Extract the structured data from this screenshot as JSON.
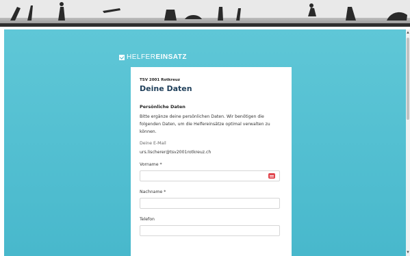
{
  "brand": {
    "light": "HELFER",
    "bold": "EINSATZ"
  },
  "club": "TSV 2001 Rotkreuz",
  "page_title": "Deine Daten",
  "section_title": "Persönliche Daten",
  "intro": "Bitte ergänze deine persönlichen Daten. Wir benötigen die folgenden Daten, um die Helfereinsätze optimal verwalten zu können.",
  "email": {
    "label": "Deine E-Mail",
    "value": "urs.lischerer@tsv2001rotkreuz.ch"
  },
  "fields": [
    {
      "label": "Vorname",
      "required": "*",
      "value": "",
      "error_icon": "password-manager-icon"
    },
    {
      "label": "Nachname",
      "required": "*",
      "value": ""
    },
    {
      "label": "Telefon",
      "required": "",
      "value": ""
    }
  ],
  "colors": {
    "background": "#4ab9cc",
    "title": "#1f3f5a",
    "error": "#e0454d"
  }
}
